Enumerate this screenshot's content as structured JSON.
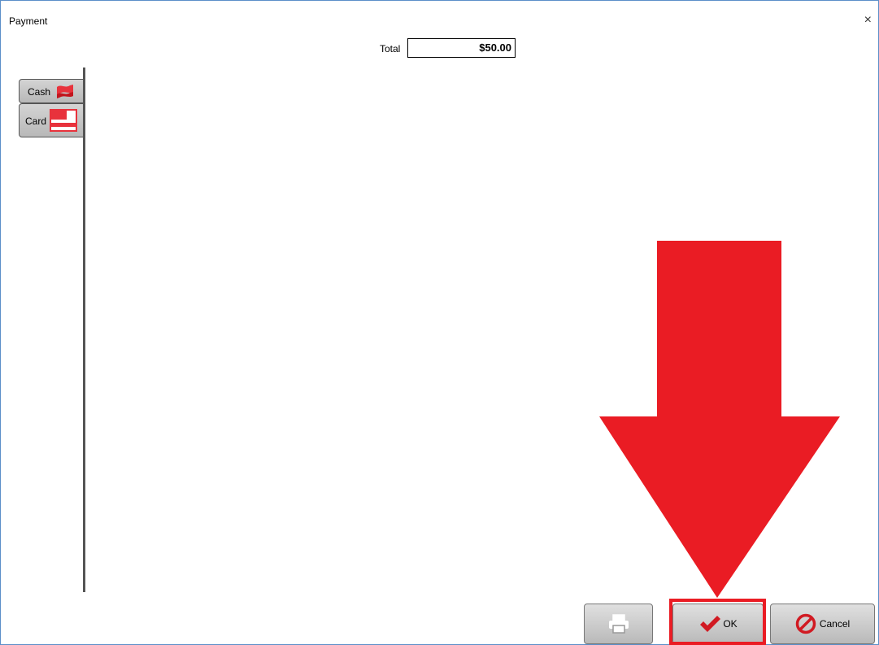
{
  "window": {
    "title": "Payment",
    "close_glyph": "×"
  },
  "total": {
    "label": "Total",
    "value": "$50.00"
  },
  "tabs": [
    {
      "label": "Cash",
      "icon": "cash-icon"
    },
    {
      "label": "Card",
      "icon": "credit-card-icon"
    }
  ],
  "buttons": {
    "print": {
      "icon": "printer-icon"
    },
    "ok": {
      "label": "OK",
      "icon": "checkmark-icon"
    },
    "cancel": {
      "label": "Cancel",
      "icon": "cancel-icon"
    }
  },
  "annotation": {
    "type": "arrow-down",
    "color": "#ea1c24",
    "highlight_target": "ok-button"
  },
  "colors": {
    "accent": "#ea1c24",
    "window_border": "#5b8fc9"
  }
}
